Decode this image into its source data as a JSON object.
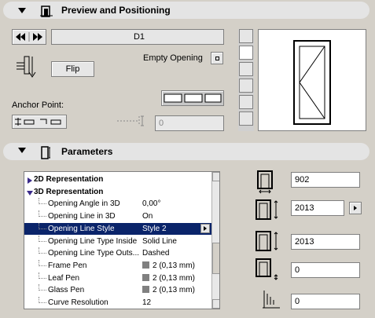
{
  "preview": {
    "title": "Preview and Positioning",
    "door_name": "D1",
    "flip_label": "Flip",
    "empty_opening_label": "Empty Opening",
    "anchor_label": "Anchor Point:",
    "offset_value": "0"
  },
  "parameters": {
    "title": "Parameters",
    "tree": [
      {
        "type": "group",
        "label": "2D Representation",
        "expanded": false
      },
      {
        "type": "group",
        "label": "3D Representation",
        "expanded": true
      },
      {
        "type": "item",
        "label": "Opening Angle in 3D",
        "value": "0,00°"
      },
      {
        "type": "item",
        "label": "Opening Line in 3D",
        "value": "On"
      },
      {
        "type": "item",
        "label": "Opening Line Style",
        "value": "Style 2",
        "selected": true
      },
      {
        "type": "item",
        "label": "Opening Line Type Inside",
        "value": "Solid Line"
      },
      {
        "type": "item",
        "label": "Opening Line Type Outs...",
        "value": "Dashed"
      },
      {
        "type": "item",
        "label": "Frame Pen",
        "value": "2 (0,13 mm)",
        "pen": true
      },
      {
        "type": "item",
        "label": "Leaf Pen",
        "value": "2 (0,13 mm)",
        "pen": true
      },
      {
        "type": "item",
        "label": "Glass Pen",
        "value": "2 (0,13 mm)",
        "pen": true
      },
      {
        "type": "item",
        "label": "Curve Resolution",
        "value": "12"
      }
    ],
    "width": "902",
    "height": "2013",
    "nominal_height": "2013",
    "sill_depth": "0",
    "sill_offset": "0"
  },
  "icons": {
    "collapse": "collapse-triangle-icon",
    "door": "door-settings-icon",
    "prev_next": "nav-arrows-icon"
  }
}
